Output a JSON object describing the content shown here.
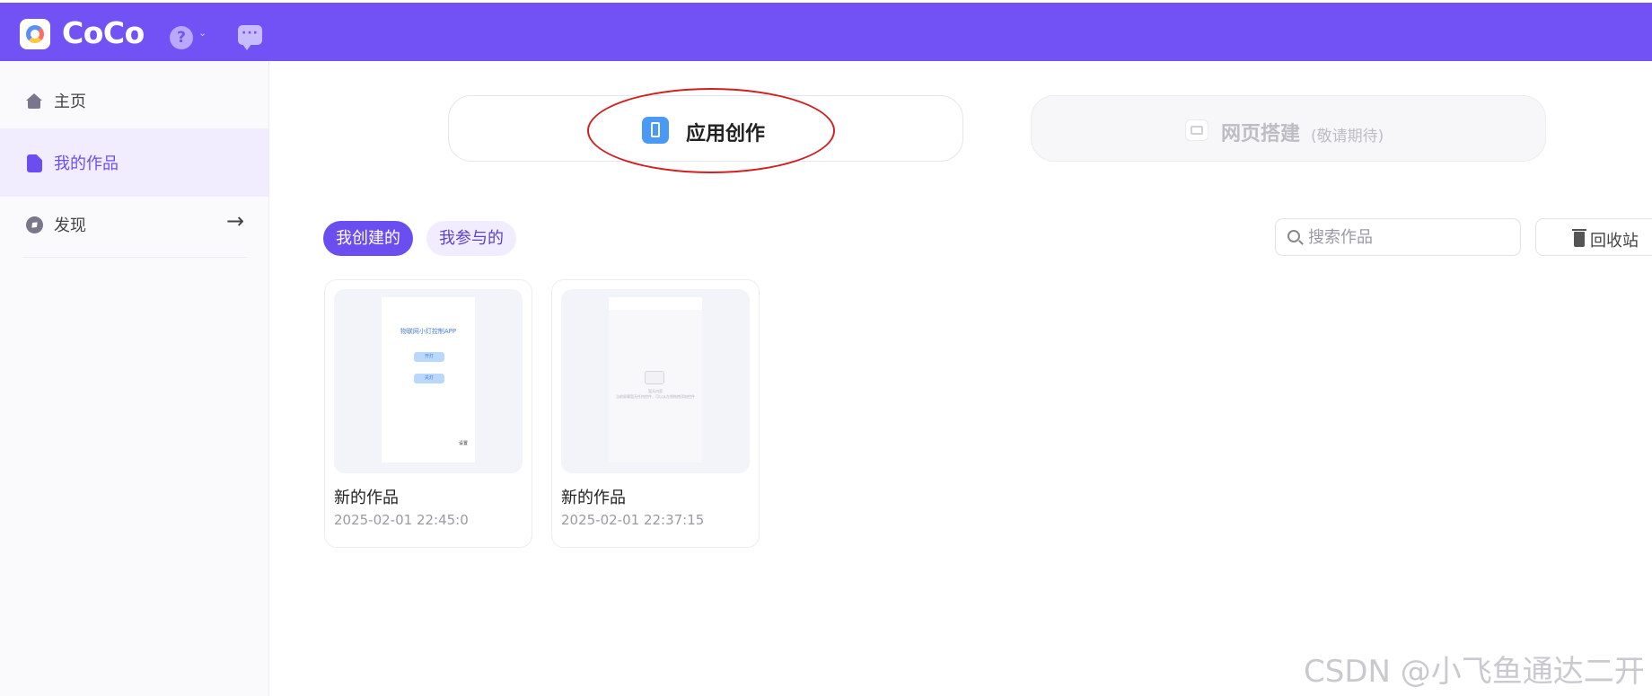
{
  "app": {
    "brand": "CoCo",
    "help_icon_text": "?",
    "chevron": "⌄",
    "chat_dots": "···"
  },
  "sidebar": {
    "items": [
      {
        "label": "主页",
        "icon": "home-icon"
      },
      {
        "label": "我的作品",
        "icon": "document-icon"
      },
      {
        "label": "发现",
        "icon": "compass-icon",
        "arrow": "→"
      }
    ]
  },
  "modes": {
    "app_creation": {
      "label": "应用创作",
      "icon": "phone-icon"
    },
    "web_build": {
      "label": "网页搭建",
      "suffix": "(敬请期待)",
      "icon": "webpage-icon"
    }
  },
  "tabs": {
    "created": "我创建的",
    "joined": "我参与的"
  },
  "search": {
    "placeholder": "搜索作品"
  },
  "recycle": {
    "label": "回收站"
  },
  "projects": [
    {
      "title": "新的作品",
      "date": "2025-02-01 22:45:0",
      "preview": {
        "title": "物联网小灯控制APP",
        "button1": "开灯",
        "button2": "关灯",
        "corner": "设置"
      }
    },
    {
      "title": "新的作品",
      "date": "2025-02-01 22:37:15",
      "preview": {
        "empty_title": "暂无内容",
        "empty_desc": "当前屏幕暂无任何控件，可以从左侧拖拽添加控件"
      }
    }
  ],
  "watermark": "CSDN @小飞鱼通达二开",
  "colors": {
    "brand": "#7352f5",
    "accent": "#6b4ef0",
    "annotation": "#d21f1f"
  }
}
